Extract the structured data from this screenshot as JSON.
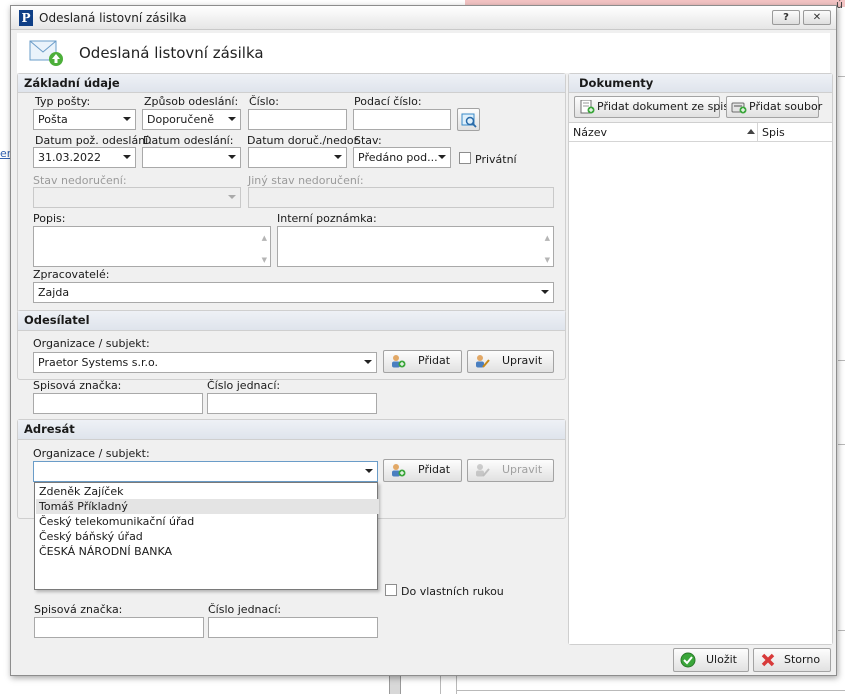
{
  "background": {
    "left_link_fragment": "em",
    "top_right_fragment": "ú"
  },
  "window": {
    "title": "Odeslaná listovní zásilka",
    "help_button": "?",
    "close_button": "✕"
  },
  "header": {
    "title": "Odeslaná listovní zásilka"
  },
  "zakladni": {
    "heading": "Základní údaje",
    "typ_label": "Typ pošty:",
    "typ_value": "Pošta",
    "zpusob_label": "Způsob odeslání:",
    "zpusob_value": "Doporučeně",
    "cislo_label": "Číslo:",
    "cislo_value": "",
    "podaci_label": "Podací číslo:",
    "podaci_value": "",
    "datum_poz_label": "Datum pož. odeslání:",
    "datum_poz_value": "31.03.2022",
    "datum_odes_label": "Datum odeslání:",
    "datum_odes_value": "",
    "datum_doruc_label": "Datum doruč./nedor.",
    "datum_doruc_value": "",
    "stav_label": "Stav:",
    "stav_value": "Předáno pod...",
    "privatni_label": "Privátní",
    "stav_nedor_label": "Stav nedoručení:",
    "jiny_stav_label": "Jiný stav nedoručení:",
    "popis_label": "Popis:",
    "interni_label": "Interní poznámka:",
    "zpracovatele_label": "Zpracovatelé:",
    "zpracovatele_value": "Zajda"
  },
  "odesilatel": {
    "heading": "Odesílatel",
    "org_label": "Organizace / subjekt:",
    "org_value": "Praetor Systems s.r.o.",
    "pridat": "Přidat",
    "upravit": "Upravit",
    "spis_label": "Spisová značka:",
    "cj_label": "Číslo jednací:"
  },
  "adresat": {
    "heading": "Adresát",
    "org_label": "Organizace / subjekt:",
    "org_value": "",
    "pridat": "Přidat",
    "upravit": "Upravit",
    "dropdown_items": [
      "Zdeněk Zajíček",
      "Tomáš Příkladný",
      "Český telekomunikační úřad",
      "Český báňský úřad",
      "ČESKÁ NÁRODNÍ BANKA"
    ],
    "vlastni_label": "Do vlastních rukou",
    "spis_label": "Spisová značka:",
    "cj_label": "Číslo jednací:"
  },
  "dokumenty": {
    "heading": "Dokumenty",
    "add_from_spis": "Přidat dokument ze spisu",
    "add_file": "Přidat soubor",
    "col_nazev": "Název",
    "col_spis": "Spis"
  },
  "footer": {
    "ulozit": "Uložit",
    "storno": "Storno"
  },
  "colors": {
    "ok_green": "#3aa63a",
    "cancel_red": "#d83a3a",
    "panel_head": "#dfe4ec"
  }
}
